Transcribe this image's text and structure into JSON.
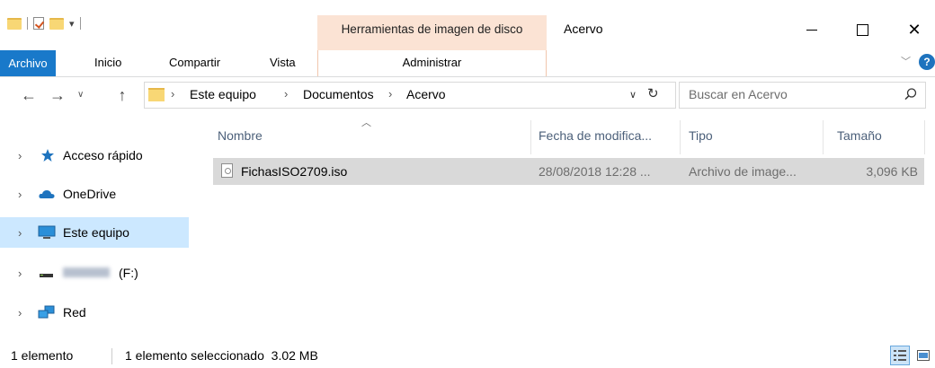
{
  "window": {
    "title": "Acervo",
    "contextual_tool_group": "Herramientas de imagen de disco"
  },
  "ribbon": {
    "tabs": [
      "Archivo",
      "Inicio",
      "Compartir",
      "Vista"
    ],
    "contextual_tab": "Administrar"
  },
  "address": {
    "breadcrumbs": [
      "Este equipo",
      "Documentos",
      "Acervo"
    ]
  },
  "search": {
    "placeholder": "Buscar en Acervo"
  },
  "nav_pane": {
    "items": [
      {
        "label": "Acceso rápido",
        "icon": "star-icon"
      },
      {
        "label": "OneDrive",
        "icon": "cloud-icon"
      },
      {
        "label": "Este equipo",
        "icon": "computer-icon",
        "selected": true
      },
      {
        "label": "(F:)",
        "icon": "drive-icon"
      },
      {
        "label": "Red",
        "icon": "network-icon"
      }
    ]
  },
  "file_list": {
    "columns": [
      "Nombre",
      "Fecha de modifica...",
      "Tipo",
      "Tamaño"
    ],
    "rows": [
      {
        "name": "FichasISO2709.iso",
        "modified": "28/08/2018 12:28 ...",
        "type": "Archivo de image...",
        "size": "3,096 KB",
        "selected": true
      }
    ]
  },
  "status_bar": {
    "item_count": "1 elemento",
    "selection": "1 elemento seleccionado  3.02 MB"
  },
  "colors": {
    "file_tab": "#1979ca",
    "contextual_tab": "#fbe3d4",
    "selection": "#cce8ff",
    "row_selected": "#d9d9d9"
  }
}
